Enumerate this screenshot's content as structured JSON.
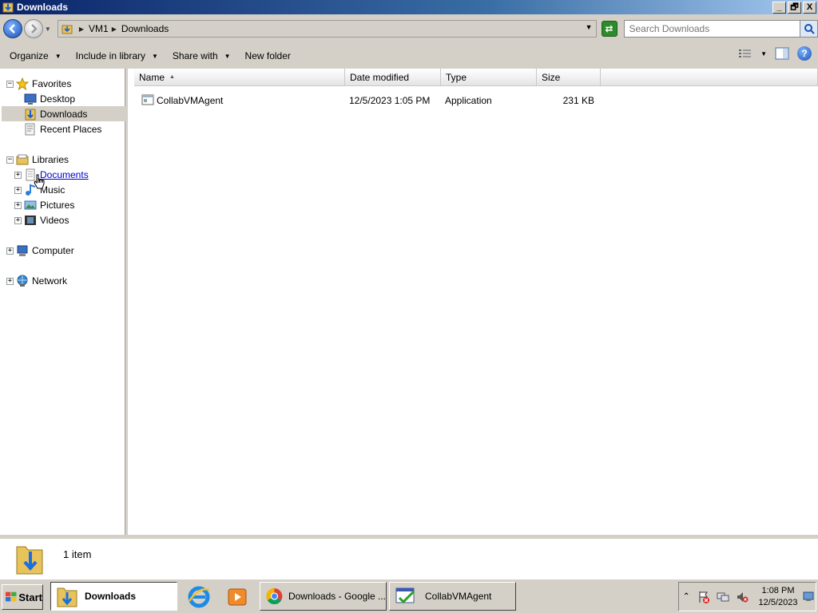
{
  "window": {
    "title": "Downloads",
    "controls": {
      "minimize": "_",
      "restore": "🗗",
      "close": "X"
    }
  },
  "address": {
    "crumbs": [
      "VM1",
      "Downloads"
    ],
    "search_placeholder": "Search Downloads"
  },
  "toolbar": {
    "organize": "Organize",
    "include_in_library": "Include in library",
    "share_with": "Share with",
    "new_folder": "New folder"
  },
  "nav": {
    "favorites": "Favorites",
    "desktop": "Desktop",
    "downloads": "Downloads",
    "recent_places": "Recent Places",
    "libraries": "Libraries",
    "documents": "Documents",
    "music": "Music",
    "pictures": "Pictures",
    "videos": "Videos",
    "computer": "Computer",
    "network": "Network"
  },
  "columns": {
    "name": "Name",
    "date_modified": "Date modified",
    "type": "Type",
    "size": "Size"
  },
  "files": [
    {
      "name": "CollabVMAgent",
      "date": "12/5/2023 1:05 PM",
      "type": "Application",
      "size": "231 KB"
    }
  ],
  "details": {
    "count": "1 item"
  },
  "taskbar": {
    "start": "Start",
    "explorer": "Downloads",
    "chrome": "Downloads - Google ...",
    "agent": "CollabVMAgent"
  },
  "clock": {
    "time": "1:08 PM",
    "date": "12/5/2023"
  },
  "colors": {
    "title_start": "#0a246a",
    "title_end": "#a6caf0",
    "face": "#d4d0c8",
    "link": "#0000cc"
  }
}
